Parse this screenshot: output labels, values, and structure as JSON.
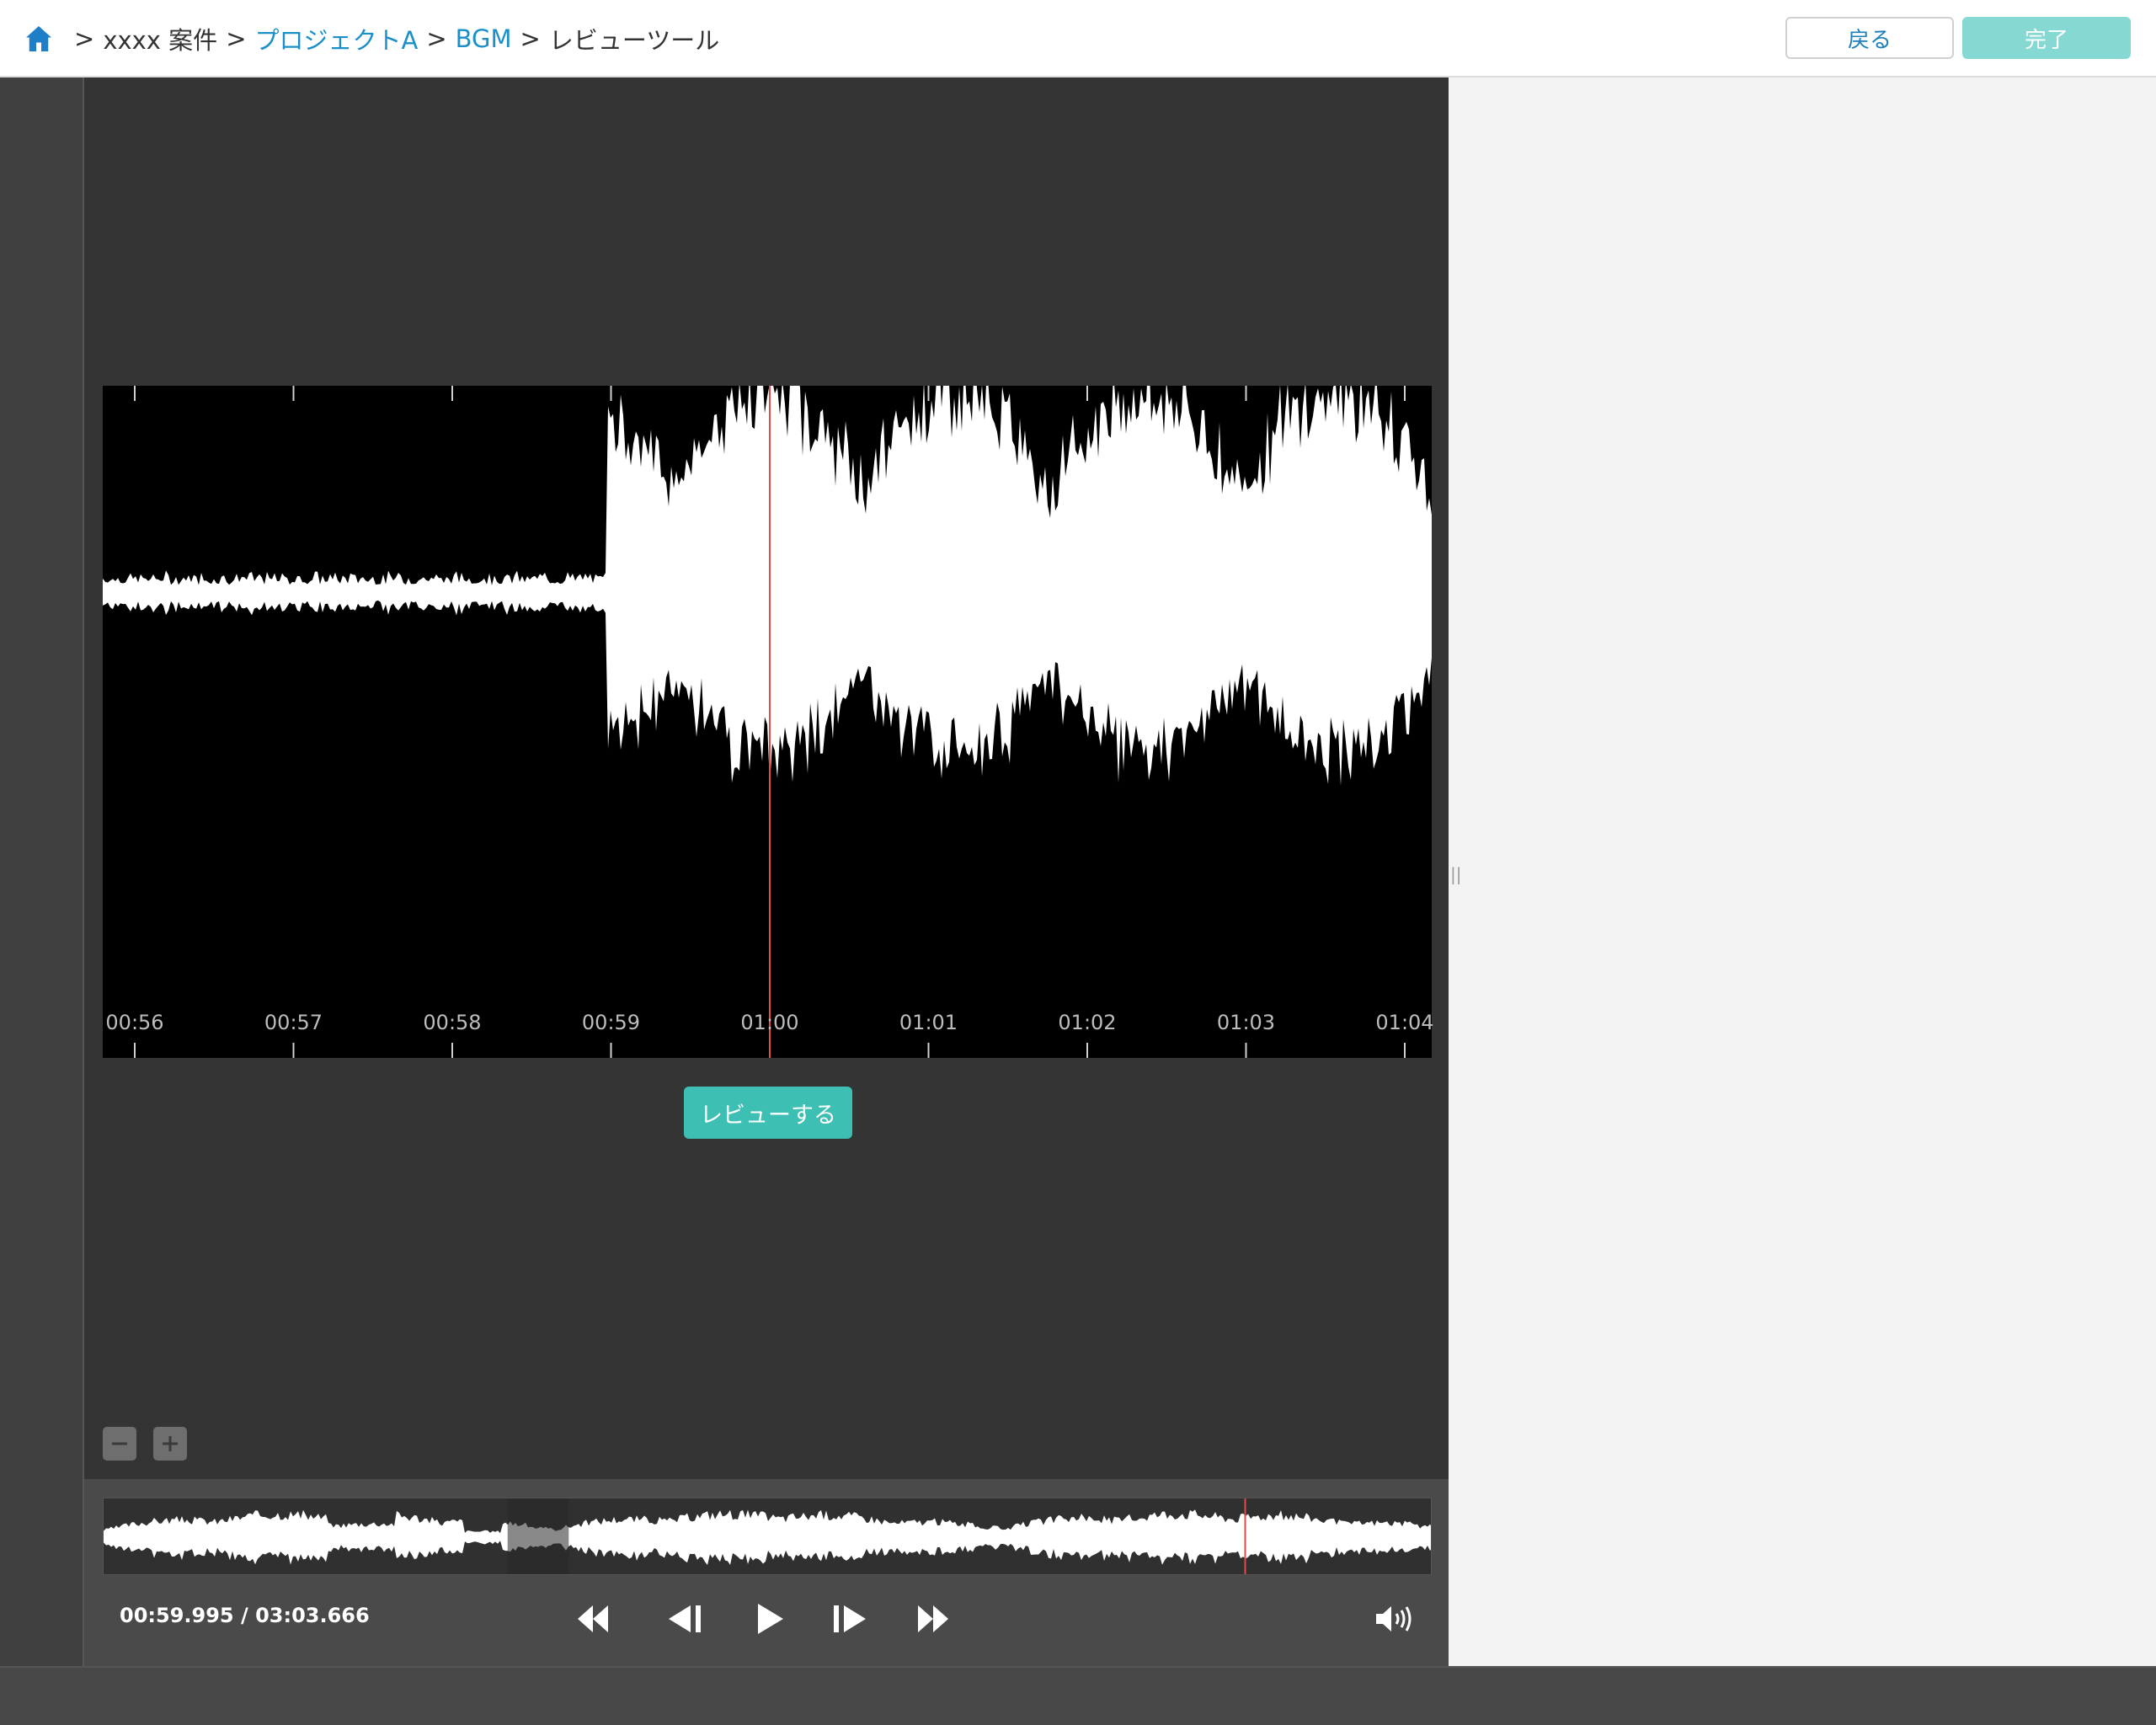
{
  "breadcrumb": {
    "items": [
      {
        "label": "xxxx 案件",
        "link": false
      },
      {
        "label": "プロジェクトA",
        "link": true
      },
      {
        "label": "BGM",
        "link": true
      },
      {
        "label": "レビューツール",
        "link": false
      }
    ],
    "separator": ">"
  },
  "header": {
    "back_label": "戻る",
    "done_label": "完了"
  },
  "waveform": {
    "tick_labels": [
      "00:56",
      "00:57",
      "00:58",
      "00:59",
      "01:00",
      "01:01",
      "01:02",
      "01:03",
      "01:04"
    ],
    "playhead_time": "01:00"
  },
  "review_button_label": "レビューする",
  "zoom": {
    "out_icon": "minus-icon",
    "in_icon": "plus-icon"
  },
  "player": {
    "current_time": "00:59.995",
    "duration": "03:03.666",
    "time_separator": "/",
    "progress_fraction": 0.327,
    "view_window": [
      0.304,
      0.35
    ],
    "marker_fraction": 0.859
  },
  "splitter_glyph": "||",
  "colors": {
    "accent": "#3ebfb3",
    "playhead": "#e04b4b",
    "link": "#1a8fc8",
    "header_home": "#1e7ec8"
  }
}
